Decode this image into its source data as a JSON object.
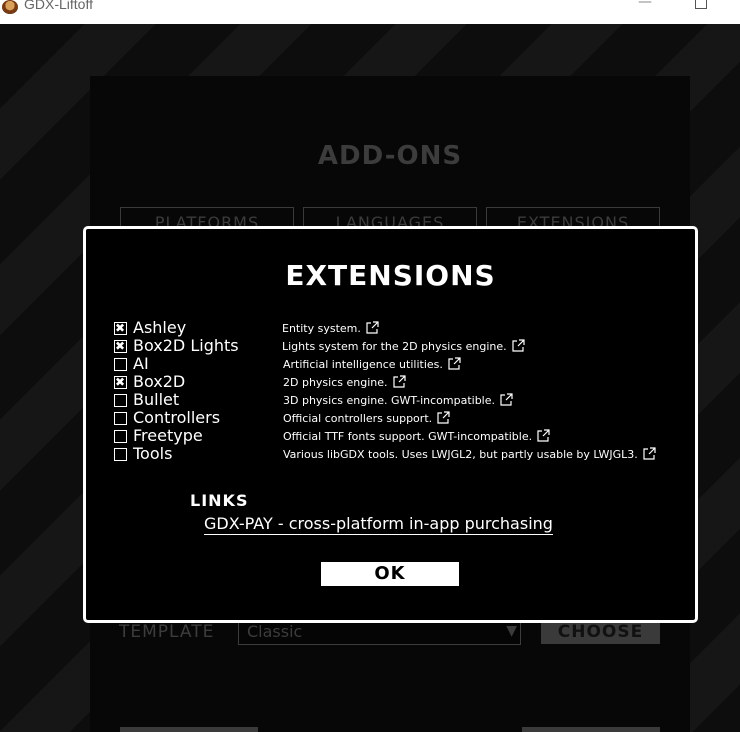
{
  "window": {
    "title": "GDX-Liftoff",
    "minimize_glyph": "—"
  },
  "background": {
    "title": "ADD-ONS",
    "tabs": [
      "PLATFORMS",
      "LANGUAGES",
      "EXTENSIONS"
    ],
    "template_label": "TEMPLATE",
    "template_value": "Classic",
    "template_arrow": "▼",
    "choose_label": "CHOOSE"
  },
  "dialog": {
    "title": "EXTENSIONS",
    "extensions": [
      {
        "name": "Ashley",
        "description": "Entity system.",
        "checked": true
      },
      {
        "name": "Box2D Lights",
        "description": "Lights system for the 2D physics engine.",
        "checked": true
      },
      {
        "name": "AI",
        "description": "Artificial intelligence utilities.",
        "checked": false
      },
      {
        "name": "Box2D",
        "description": "2D physics engine.",
        "checked": true
      },
      {
        "name": "Bullet",
        "description": "3D physics engine. GWT-incompatible.",
        "checked": false
      },
      {
        "name": "Controllers",
        "description": "Official controllers support.",
        "checked": false
      },
      {
        "name": "Freetype",
        "description": "Official TTF fonts support. GWT-incompatible.",
        "checked": false
      },
      {
        "name": "Tools",
        "description": "Various libGDX tools. Uses LWJGL2, but partly usable by LWJGL3.",
        "checked": false
      }
    ],
    "links_title": "LINKS",
    "link_text": "GDX-PAY - cross-platform in-app purchasing",
    "ok_label": "OK"
  }
}
